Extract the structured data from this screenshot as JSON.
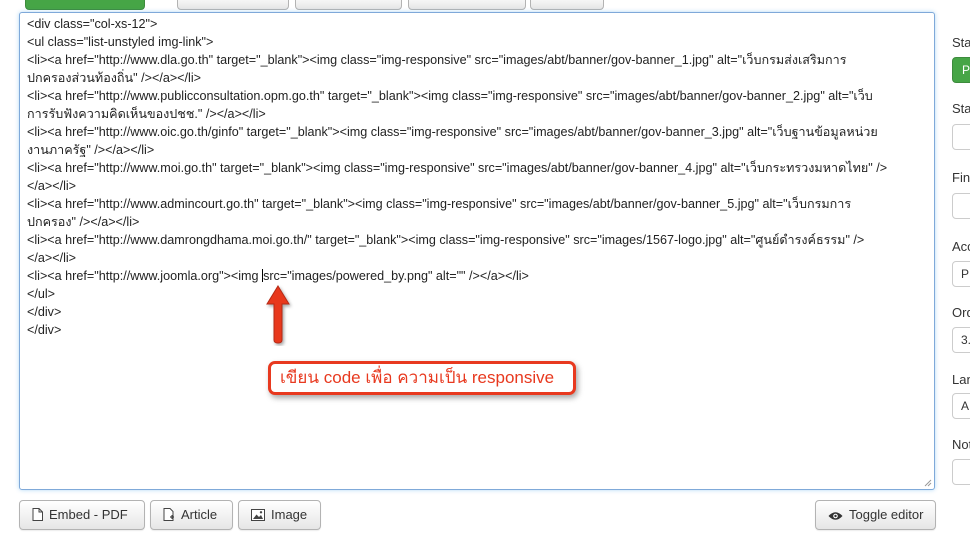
{
  "editor": {
    "lines": [
      "<div class=\"col-xs-12\">",
      "<ul class=\"list-unstyled img-link\">",
      "<li><a href=\"http://www.dla.go.th\" target=\"_blank\"><img class=\"img-responsive\" src=\"images/abt/banner/gov-banner_1.jpg\" alt=\"เว็บกรมส่งเสริมการ",
      "ปกครองส่วนท้องถิ่น\" /></a></li>",
      "<li><a href=\"http://www.publicconsultation.opm.go.th\" target=\"_blank\"><img class=\"img-responsive\" src=\"images/abt/banner/gov-banner_2.jpg\" alt=\"เว็บ",
      "การรับฟังความคิดเห็นของปชช.\" /></a></li>",
      "<li><a href=\"http://www.oic.go.th/ginfo\" target=\"_blank\"><img class=\"img-responsive\" src=\"images/abt/banner/gov-banner_3.jpg\" alt=\"เว็บฐานข้อมูลหน่วย",
      "งานภาครัฐ\" /></a></li>",
      "<li><a href=\"http://www.moi.go.th\" target=\"_blank\"><img class=\"img-responsive\" src=\"images/abt/banner/gov-banner_4.jpg\" alt=\"เว็บกระทรวงมหาดไทย\" />",
      "</a></li>",
      "<li><a href=\"http://www.admincourt.go.th\" target=\"_blank\"><img class=\"img-responsive\" src=\"images/abt/banner/gov-banner_5.jpg\" alt=\"เว็บกรมการ",
      "ปกครอง\" /></a></li>",
      "<li><a href=\"http://www.damrongdhama.moi.go.th/\" target=\"_blank\"><img class=\"img-responsive\" src=\"images/1567-logo.jpg\" alt=\"ศูนย์ดำรงค์ธรรม\" />",
      "</a></li>",
      "<li><a href=\"http://www.joomla.org\"><img ",
      "</ul>",
      "</div>",
      "</div>"
    ],
    "caret_line_rest": "src=\"images/powered_by.png\" alt=\"\" /></a></li>"
  },
  "annotation": {
    "text": "เขียน code เพื่อ ความเป็น responsive",
    "color": "#e8391f"
  },
  "buttons": {
    "embed_pdf": "Embed - PDF",
    "article": "Article",
    "image": "Image",
    "toggle_editor": "Toggle editor"
  },
  "sidebar": {
    "status_label": "Sta",
    "status_value": "P",
    "start_label": "Sta",
    "finish_label": "Fin",
    "access_label": "Acc",
    "access_value": "P",
    "ordering_label": "Ord",
    "ordering_value": "3.",
    "language_label": "Lan",
    "language_value": "A",
    "note_label": "Not"
  },
  "colors": {
    "accent_green": "#46a546",
    "focus_blue": "#7fa9d9",
    "annotation_red": "#e8391f"
  }
}
